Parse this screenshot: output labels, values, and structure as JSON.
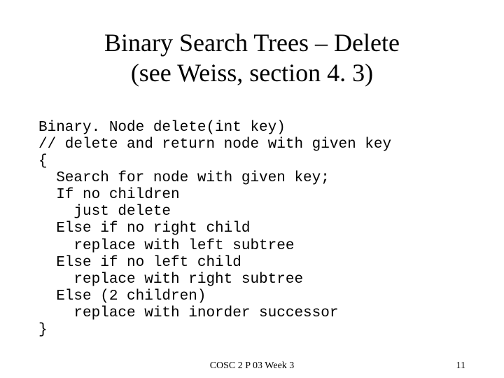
{
  "title_line1": "Binary Search Trees – Delete",
  "title_line2": "(see Weiss, section 4. 3)",
  "code": {
    "l0": "Binary. Node delete(int key)",
    "l1": "// delete and return node with given key",
    "l2": "{",
    "l3": "  Search for node with given key;",
    "l4": "  If no children",
    "l5": "    just delete",
    "l6": "  Else if no right child",
    "l7": "    replace with left subtree",
    "l8": "  Else if no left child",
    "l9": "    replace with right subtree",
    "l10": "  Else (2 children)",
    "l11": "    replace with inorder successor",
    "l12": "}"
  },
  "footer": {
    "center": "COSC 2 P 03 Week 3",
    "page": "11"
  }
}
